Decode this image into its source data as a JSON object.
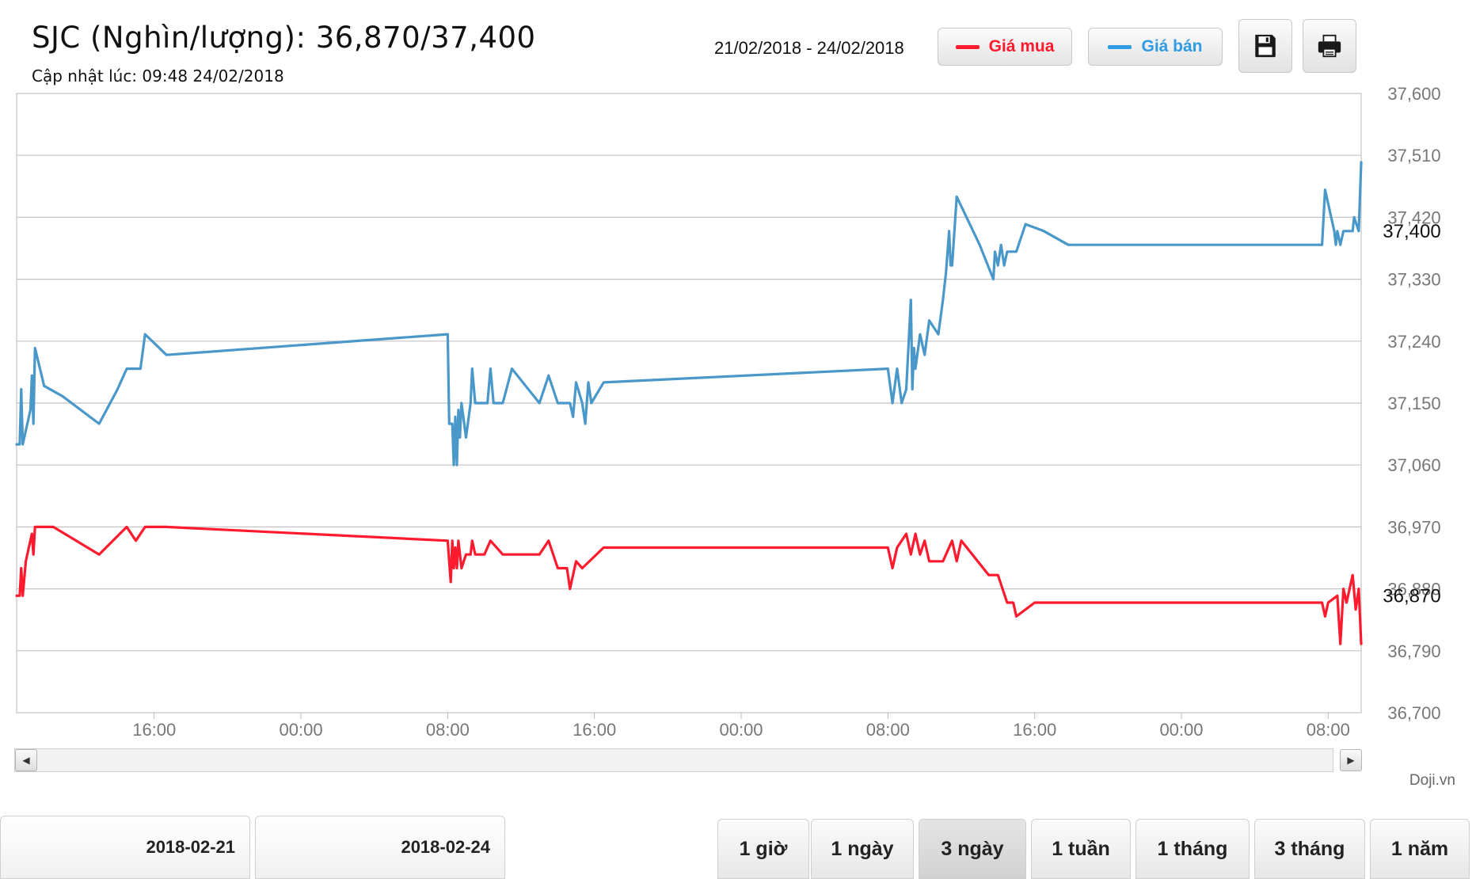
{
  "header": {
    "title": "SJC (Nghìn/lượng): 36,870/37,400",
    "updated": "Cập nhật lúc: 09:48 24/02/2018",
    "date_range": "21/02/2018 - 24/02/2018"
  },
  "legend": {
    "buy_label": "Giá mua",
    "sell_label": "Giá bán",
    "buy_color": "#ff1a2e",
    "sell_color": "#4a98c9"
  },
  "toolbar": {
    "save_icon": "floppy-disk-icon",
    "print_icon": "printer-icon"
  },
  "credit": "Doji.vn",
  "date_inputs": {
    "from": "2018-02-21",
    "to": "2018-02-24"
  },
  "ranges": [
    "1 giờ",
    "1 ngày",
    "3 ngày",
    "1 tuần",
    "1 tháng",
    "3 tháng",
    "1 năm"
  ],
  "active_range": "3 ngày",
  "chart_data": {
    "type": "line",
    "grid": true,
    "y_axis_position": "right",
    "ylim": [
      36700,
      37600
    ],
    "yticks": [
      "37,600",
      "37,510",
      "37,420",
      "37,330",
      "37,240",
      "37,150",
      "37,060",
      "36,970",
      "36,880",
      "36,790",
      "36,700"
    ],
    "xlim": [
      "2018-02-21T08:30",
      "2018-02-24T09:48"
    ],
    "xticks": [
      {
        "label": "16:00",
        "t": "2018-02-21T16:00"
      },
      {
        "label": "00:00",
        "t": "2018-02-22T00:00"
      },
      {
        "label": "08:00",
        "t": "2018-02-22T08:00"
      },
      {
        "label": "16:00",
        "t": "2018-02-22T16:00"
      },
      {
        "label": "00:00",
        "t": "2018-02-23T00:00"
      },
      {
        "label": "08:00",
        "t": "2018-02-23T08:00"
      },
      {
        "label": "16:00",
        "t": "2018-02-23T16:00"
      },
      {
        "label": "00:00",
        "t": "2018-02-24T00:00"
      },
      {
        "label": "08:00",
        "t": "2018-02-24T08:00"
      }
    ],
    "last_value_labels": {
      "buy": "36,870",
      "sell": "37,400"
    },
    "series": [
      {
        "name": "Giá bán",
        "color": "#4a98c9",
        "points": [
          [
            "2018-02-21T08:30",
            37090
          ],
          [
            "2018-02-21T08:40",
            37090
          ],
          [
            "2018-02-21T08:45",
            37170
          ],
          [
            "2018-02-21T08:50",
            37090
          ],
          [
            "2018-02-21T09:00",
            37110
          ],
          [
            "2018-02-21T09:15",
            37140
          ],
          [
            "2018-02-21T09:20",
            37190
          ],
          [
            "2018-02-21T09:25",
            37120
          ],
          [
            "2018-02-21T09:30",
            37230
          ],
          [
            "2018-02-21T10:00",
            37175
          ],
          [
            "2018-02-21T11:00",
            37160
          ],
          [
            "2018-02-21T13:00",
            37120
          ],
          [
            "2018-02-21T14:00",
            37170
          ],
          [
            "2018-02-21T14:30",
            37200
          ],
          [
            "2018-02-21T15:15",
            37200
          ],
          [
            "2018-02-21T15:30",
            37250
          ],
          [
            "2018-02-21T16:40",
            37220
          ],
          [
            "2018-02-22T08:00",
            37250
          ],
          [
            "2018-02-22T08:05",
            37120
          ],
          [
            "2018-02-22T08:15",
            37120
          ],
          [
            "2018-02-22T08:20",
            37060
          ],
          [
            "2018-02-22T08:25",
            37130
          ],
          [
            "2018-02-22T08:30",
            37060
          ],
          [
            "2018-02-22T08:35",
            37140
          ],
          [
            "2018-02-22T08:40",
            37100
          ],
          [
            "2018-02-22T08:45",
            37150
          ],
          [
            "2018-02-22T09:00",
            37100
          ],
          [
            "2018-02-22T09:15",
            37150
          ],
          [
            "2018-02-22T09:20",
            37200
          ],
          [
            "2018-02-22T09:30",
            37150
          ],
          [
            "2018-02-22T10:10",
            37150
          ],
          [
            "2018-02-22T10:20",
            37200
          ],
          [
            "2018-02-22T10:30",
            37150
          ],
          [
            "2018-02-22T11:00",
            37150
          ],
          [
            "2018-02-22T11:30",
            37200
          ],
          [
            "2018-02-22T13:00",
            37150
          ],
          [
            "2018-02-22T13:30",
            37190
          ],
          [
            "2018-02-22T14:00",
            37150
          ],
          [
            "2018-02-22T14:40",
            37150
          ],
          [
            "2018-02-22T14:50",
            37130
          ],
          [
            "2018-02-22T15:00",
            37180
          ],
          [
            "2018-02-22T15:20",
            37150
          ],
          [
            "2018-02-22T15:30",
            37120
          ],
          [
            "2018-02-22T15:40",
            37180
          ],
          [
            "2018-02-22T15:50",
            37150
          ],
          [
            "2018-02-22T16:30",
            37180
          ],
          [
            "2018-02-23T08:00",
            37200
          ],
          [
            "2018-02-23T08:15",
            37150
          ],
          [
            "2018-02-23T08:30",
            37200
          ],
          [
            "2018-02-23T08:45",
            37150
          ],
          [
            "2018-02-23T09:00",
            37170
          ],
          [
            "2018-02-23T09:15",
            37300
          ],
          [
            "2018-02-23T09:20",
            37170
          ],
          [
            "2018-02-23T09:25",
            37230
          ],
          [
            "2018-02-23T09:30",
            37200
          ],
          [
            "2018-02-23T09:45",
            37250
          ],
          [
            "2018-02-23T10:00",
            37220
          ],
          [
            "2018-02-23T10:15",
            37270
          ],
          [
            "2018-02-23T10:45",
            37250
          ],
          [
            "2018-02-23T11:00",
            37300
          ],
          [
            "2018-02-23T11:10",
            37340
          ],
          [
            "2018-02-23T11:20",
            37400
          ],
          [
            "2018-02-23T11:25",
            37350
          ],
          [
            "2018-02-23T11:30",
            37350
          ],
          [
            "2018-02-23T11:45",
            37450
          ],
          [
            "2018-02-23T13:00",
            37380
          ],
          [
            "2018-02-23T13:45",
            37330
          ],
          [
            "2018-02-23T13:50",
            37370
          ],
          [
            "2018-02-23T14:00",
            37350
          ],
          [
            "2018-02-23T14:10",
            37380
          ],
          [
            "2018-02-23T14:20",
            37350
          ],
          [
            "2018-02-23T14:30",
            37370
          ],
          [
            "2018-02-23T15:00",
            37370
          ],
          [
            "2018-02-23T15:30",
            37410
          ],
          [
            "2018-02-23T16:30",
            37400
          ],
          [
            "2018-02-23T17:50",
            37380
          ],
          [
            "2018-02-24T07:40",
            37380
          ],
          [
            "2018-02-24T07:50",
            37460
          ],
          [
            "2018-02-24T08:20",
            37400
          ],
          [
            "2018-02-24T08:25",
            37380
          ],
          [
            "2018-02-24T08:30",
            37400
          ],
          [
            "2018-02-24T08:40",
            37380
          ],
          [
            "2018-02-24T08:50",
            37400
          ],
          [
            "2018-02-24T09:20",
            37400
          ],
          [
            "2018-02-24T09:25",
            37420
          ],
          [
            "2018-02-24T09:40",
            37400
          ],
          [
            "2018-02-24T09:48",
            37500
          ]
        ]
      },
      {
        "name": "Giá mua",
        "color": "#ff1a2e",
        "points": [
          [
            "2018-02-21T08:30",
            36870
          ],
          [
            "2018-02-21T08:40",
            36870
          ],
          [
            "2018-02-21T08:45",
            36910
          ],
          [
            "2018-02-21T08:50",
            36870
          ],
          [
            "2018-02-21T09:00",
            36920
          ],
          [
            "2018-02-21T09:10",
            36940
          ],
          [
            "2018-02-21T09:20",
            36960
          ],
          [
            "2018-02-21T09:25",
            36930
          ],
          [
            "2018-02-21T09:30",
            36970
          ],
          [
            "2018-02-21T10:30",
            36970
          ],
          [
            "2018-02-21T13:00",
            36930
          ],
          [
            "2018-02-21T14:30",
            36970
          ],
          [
            "2018-02-21T15:00",
            36950
          ],
          [
            "2018-02-21T15:30",
            36970
          ],
          [
            "2018-02-21T16:40",
            36970
          ],
          [
            "2018-02-22T08:00",
            36950
          ],
          [
            "2018-02-22T08:10",
            36890
          ],
          [
            "2018-02-22T08:15",
            36950
          ],
          [
            "2018-02-22T08:20",
            36910
          ],
          [
            "2018-02-22T08:25",
            36940
          ],
          [
            "2018-02-22T08:30",
            36910
          ],
          [
            "2018-02-22T08:35",
            36950
          ],
          [
            "2018-02-22T08:45",
            36910
          ],
          [
            "2018-02-22T09:00",
            36930
          ],
          [
            "2018-02-22T09:15",
            36930
          ],
          [
            "2018-02-22T09:20",
            36950
          ],
          [
            "2018-02-22T09:30",
            36930
          ],
          [
            "2018-02-22T10:00",
            36930
          ],
          [
            "2018-02-22T10:20",
            36950
          ],
          [
            "2018-02-22T11:00",
            36930
          ],
          [
            "2018-02-22T13:00",
            36930
          ],
          [
            "2018-02-22T13:30",
            36950
          ],
          [
            "2018-02-22T14:00",
            36910
          ],
          [
            "2018-02-22T14:30",
            36910
          ],
          [
            "2018-02-22T14:40",
            36880
          ],
          [
            "2018-02-22T15:00",
            36920
          ],
          [
            "2018-02-22T15:20",
            36910
          ],
          [
            "2018-02-22T16:30",
            36940
          ],
          [
            "2018-02-23T08:00",
            36940
          ],
          [
            "2018-02-23T08:15",
            36910
          ],
          [
            "2018-02-23T08:30",
            36940
          ],
          [
            "2018-02-23T09:00",
            36960
          ],
          [
            "2018-02-23T09:15",
            36930
          ],
          [
            "2018-02-23T09:30",
            36960
          ],
          [
            "2018-02-23T09:45",
            36930
          ],
          [
            "2018-02-23T10:00",
            36950
          ],
          [
            "2018-02-23T10:15",
            36920
          ],
          [
            "2018-02-23T11:00",
            36920
          ],
          [
            "2018-02-23T11:30",
            36950
          ],
          [
            "2018-02-23T11:45",
            36920
          ],
          [
            "2018-02-23T12:00",
            36950
          ],
          [
            "2018-02-23T13:30",
            36900
          ],
          [
            "2018-02-23T14:00",
            36900
          ],
          [
            "2018-02-23T14:30",
            36860
          ],
          [
            "2018-02-23T14:50",
            36860
          ],
          [
            "2018-02-23T15:00",
            36840
          ],
          [
            "2018-02-23T16:00",
            36860
          ],
          [
            "2018-02-24T07:40",
            36860
          ],
          [
            "2018-02-24T07:50",
            36840
          ],
          [
            "2018-02-24T08:00",
            36860
          ],
          [
            "2018-02-24T08:30",
            36870
          ],
          [
            "2018-02-24T08:40",
            36800
          ],
          [
            "2018-02-24T08:50",
            36880
          ],
          [
            "2018-02-24T09:00",
            36860
          ],
          [
            "2018-02-24T09:20",
            36900
          ],
          [
            "2018-02-24T09:30",
            36850
          ],
          [
            "2018-02-24T09:40",
            36880
          ],
          [
            "2018-02-24T09:48",
            36800
          ]
        ]
      }
    ]
  }
}
